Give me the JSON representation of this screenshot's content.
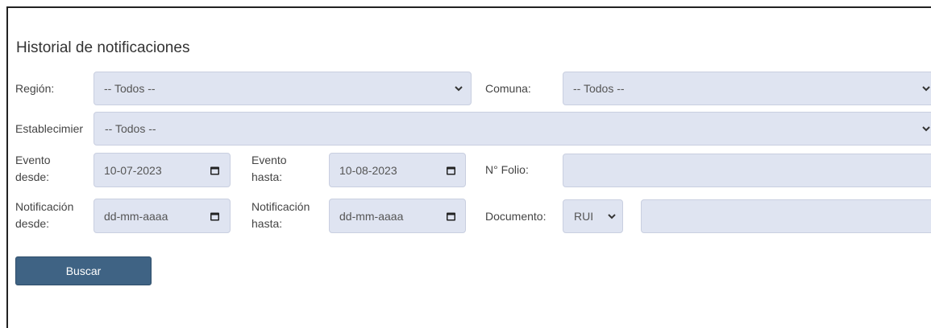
{
  "title": "Historial de notificaciones",
  "filters": {
    "region": {
      "label": "Región:",
      "value": "-- Todos --"
    },
    "comuna": {
      "label": "Comuna:",
      "value": "-- Todos --"
    },
    "establecimiento": {
      "label": "Establecimier",
      "value": "-- Todos --"
    },
    "evento_desde": {
      "label_line1": "Evento",
      "label_line2": "desde:",
      "value": "10-07-2023"
    },
    "evento_hasta": {
      "label_line1": "Evento",
      "label_line2": "hasta:",
      "value": "10-08-2023"
    },
    "folio": {
      "label": "N° Folio:",
      "value": ""
    },
    "notificacion_desde": {
      "label_line1": "Notificación",
      "label_line2": "desde:",
      "value": "dd-mm-aaaa"
    },
    "notificacion_hasta": {
      "label_line1": "Notificación",
      "label_line2": "hasta:",
      "value": "dd-mm-aaaa"
    },
    "documento": {
      "label": "Documento:",
      "type_value": "RUI",
      "number_value": ""
    }
  },
  "actions": {
    "search_label": "Buscar"
  },
  "icons": {
    "select": "chevron-down-icon",
    "date": "calendar-icon"
  }
}
